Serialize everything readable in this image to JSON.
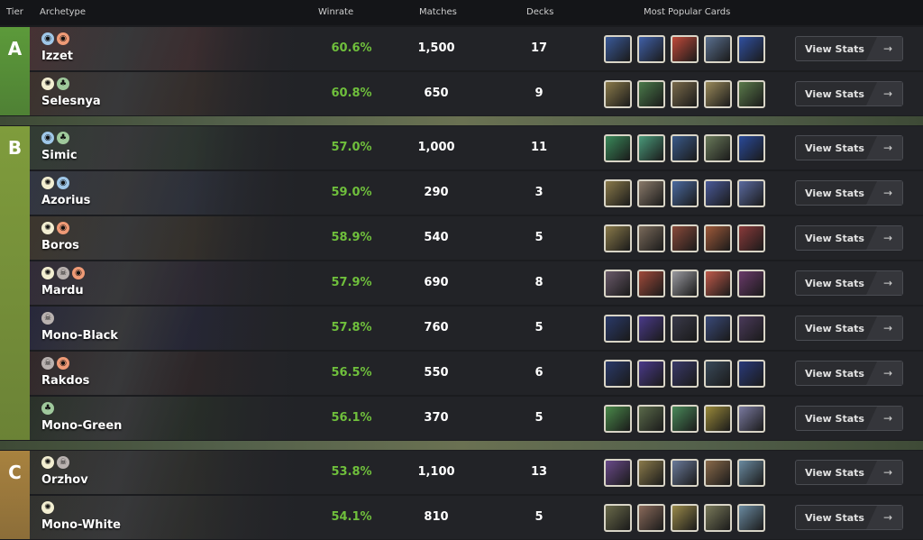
{
  "header": {
    "tier": "Tier",
    "archetype": "Archetype",
    "winrate": "Winrate",
    "matches": "Matches",
    "decks": "Decks",
    "cards": "Most Popular Cards"
  },
  "button_label": "View Stats",
  "button_arrow": "→",
  "tiers": [
    {
      "letter": "A",
      "color": "#5c9a3a",
      "rows": [
        {
          "name": "Izzet",
          "colors": [
            "u",
            "r"
          ],
          "winrate": "60.6%",
          "matches": "1,500",
          "decks": "17",
          "art": "#5a3a3a",
          "cards": [
            "#3a5a9a",
            "#4060a8",
            "#c04a3a",
            "#5a7090",
            "#3050a0"
          ]
        },
        {
          "name": "Selesnya",
          "colors": [
            "w",
            "g"
          ],
          "winrate": "60.8%",
          "matches": "650",
          "decks": "9",
          "art": "#4a3a30",
          "cards": [
            "#8a7a4a",
            "#4a7a4a",
            "#7a6a4a",
            "#9a8a5a",
            "#5a7a4a"
          ]
        }
      ]
    },
    {
      "letter": "B",
      "color": "#7f9c3c",
      "rows": [
        {
          "name": "Simic",
          "colors": [
            "u",
            "g"
          ],
          "winrate": "57.0%",
          "matches": "1,000",
          "decks": "11",
          "art": "#3a4a3a",
          "cards": [
            "#3a8a5a",
            "#4a9a7a",
            "#3a5a8a",
            "#6a7a5a",
            "#2a4a9a"
          ]
        },
        {
          "name": "Azorius",
          "colors": [
            "w",
            "u"
          ],
          "winrate": "59.0%",
          "matches": "290",
          "decks": "3",
          "art": "#3a4050",
          "cards": [
            "#8a7a4a",
            "#8a7a6a",
            "#4a6aa0",
            "#4a5a9a",
            "#5a6aa0"
          ]
        },
        {
          "name": "Boros",
          "colors": [
            "w",
            "r"
          ],
          "winrate": "58.9%",
          "matches": "540",
          "decks": "5",
          "art": "#4a4030",
          "cards": [
            "#8a7a4a",
            "#7a6a5a",
            "#8a4a3a",
            "#a05a3a",
            "#8a3a3a"
          ]
        },
        {
          "name": "Mardu",
          "colors": [
            "w",
            "b",
            "r"
          ],
          "winrate": "57.9%",
          "matches": "690",
          "decks": "8",
          "art": "#3a3040",
          "cards": [
            "#6a5a6a",
            "#a04a3a",
            "#9a9aa0",
            "#c05a4a",
            "#6a3a6a"
          ]
        },
        {
          "name": "Mono-Black",
          "colors": [
            "b"
          ],
          "winrate": "57.8%",
          "matches": "760",
          "decks": "5",
          "art": "#2a2a45",
          "cards": [
            "#2a3a6a",
            "#4a3a8a",
            "#3a3a4a",
            "#3a4a7a",
            "#4a3a5a"
          ]
        },
        {
          "name": "Rakdos",
          "colors": [
            "b",
            "r"
          ],
          "winrate": "56.5%",
          "matches": "550",
          "decks": "6",
          "art": "#3a2a2a",
          "cards": [
            "#2a3a6a",
            "#4a3a8a",
            "#3a3a6a",
            "#3a4a5a",
            "#2a3a7a"
          ]
        },
        {
          "name": "Mono-Green",
          "colors": [
            "g"
          ],
          "winrate": "56.1%",
          "matches": "370",
          "decks": "5",
          "art": "#2e3a2a",
          "cards": [
            "#4a8a4a",
            "#5a6a4a",
            "#4a8a5a",
            "#9a8a3a",
            "#7a7aa0"
          ]
        }
      ]
    },
    {
      "letter": "C",
      "color": "#a8823f",
      "rows": [
        {
          "name": "Orzhov",
          "colors": [
            "w",
            "b"
          ],
          "winrate": "53.8%",
          "matches": "1,100",
          "decks": "13",
          "art": "#3a3a30",
          "cards": [
            "#6a4a8a",
            "#8a7a4a",
            "#6a7a9a",
            "#8a6a4a",
            "#6a8aa0"
          ]
        },
        {
          "name": "Mono-White",
          "colors": [
            "w"
          ],
          "winrate": "54.1%",
          "matches": "810",
          "decks": "5",
          "art": "#3a3a32",
          "cards": [
            "#6a6a4a",
            "#8a6a5a",
            "#9a8a4a",
            "#7a7a5a",
            "#6a8aa0"
          ]
        }
      ]
    }
  ],
  "mana_glyphs": {
    "u": "💧",
    "r": "🔥",
    "w": "☀",
    "g": "🌲",
    "b": "💀"
  }
}
